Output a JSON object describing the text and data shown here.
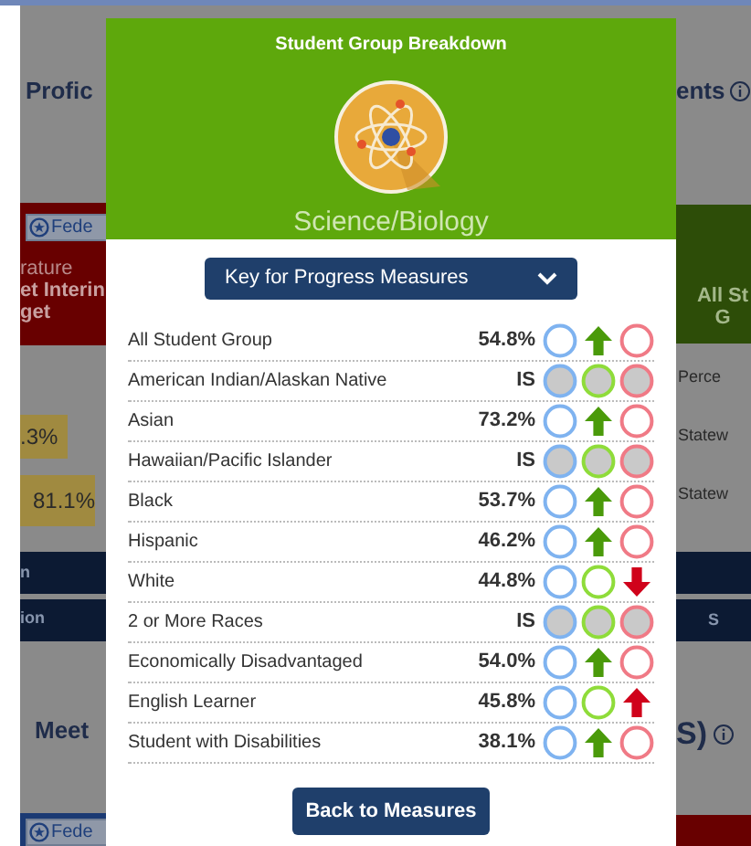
{
  "background": {
    "left": {
      "heading": "Profic",
      "badge_top": "Fede",
      "card_lines": [
        "rature",
        "et Interin",
        "get"
      ],
      "values": [
        ".3%",
        "81.1%"
      ],
      "bands": [
        "n",
        "ion"
      ],
      "subheading": "Meet",
      "badge_bottom": "Fede"
    },
    "right": {
      "heading": "ents",
      "card_lines": [
        "All St",
        "G"
      ],
      "labels": [
        "Perce",
        "Statew",
        "Statew"
      ],
      "bands": [
        "S"
      ],
      "subheading": "S)"
    }
  },
  "modal": {
    "title": "Student Group Breakdown",
    "subject": "Science/Biology",
    "key_dropdown": {
      "label": "Key for Progress Measures",
      "expanded": false
    },
    "rows": [
      {
        "label": "All Student Group",
        "value": "54.8%",
        "marks": [
          {
            "kind": "circle",
            "grayed": false
          },
          {
            "kind": "uparrow"
          },
          {
            "kind": "circle",
            "grayed": false
          }
        ]
      },
      {
        "label": "American Indian/Alaskan Native",
        "value": "IS",
        "marks": [
          {
            "kind": "circle",
            "grayed": true
          },
          {
            "kind": "circle",
            "grayed": true
          },
          {
            "kind": "circle",
            "grayed": true
          }
        ]
      },
      {
        "label": "Asian",
        "value": "73.2%",
        "marks": [
          {
            "kind": "circle",
            "grayed": false
          },
          {
            "kind": "uparrow"
          },
          {
            "kind": "circle",
            "grayed": false
          }
        ]
      },
      {
        "label": "Hawaiian/Pacific Islander",
        "value": "IS",
        "marks": [
          {
            "kind": "circle",
            "grayed": true
          },
          {
            "kind": "circle",
            "grayed": true
          },
          {
            "kind": "circle",
            "grayed": true
          }
        ]
      },
      {
        "label": "Black",
        "value": "53.7%",
        "marks": [
          {
            "kind": "circle",
            "grayed": false
          },
          {
            "kind": "uparrow"
          },
          {
            "kind": "circle",
            "grayed": false
          }
        ]
      },
      {
        "label": "Hispanic",
        "value": "46.2%",
        "marks": [
          {
            "kind": "circle",
            "grayed": false
          },
          {
            "kind": "uparrow"
          },
          {
            "kind": "circle",
            "grayed": false
          }
        ]
      },
      {
        "label": "White",
        "value": "44.8%",
        "marks": [
          {
            "kind": "circle",
            "grayed": false
          },
          {
            "kind": "circle",
            "grayed": false
          },
          {
            "kind": "downarrow"
          }
        ]
      },
      {
        "label": "2 or More Races",
        "value": "IS",
        "marks": [
          {
            "kind": "circle",
            "grayed": true
          },
          {
            "kind": "circle",
            "grayed": true
          },
          {
            "kind": "circle",
            "grayed": true
          }
        ]
      },
      {
        "label": "Economically Disadvantaged",
        "value": "54.0%",
        "marks": [
          {
            "kind": "circle",
            "grayed": false
          },
          {
            "kind": "uparrow"
          },
          {
            "kind": "circle",
            "grayed": false
          }
        ]
      },
      {
        "label": "English Learner",
        "value": "45.8%",
        "marks": [
          {
            "kind": "circle",
            "grayed": false
          },
          {
            "kind": "circle",
            "grayed": false
          },
          {
            "kind": "uparrow"
          }
        ]
      },
      {
        "label": "Student with Disabilities",
        "value": "38.1%",
        "marks": [
          {
            "kind": "circle",
            "grayed": false
          },
          {
            "kind": "uparrow"
          },
          {
            "kind": "circle",
            "grayed": false
          }
        ]
      }
    ],
    "back_button": "Back to Measures"
  }
}
